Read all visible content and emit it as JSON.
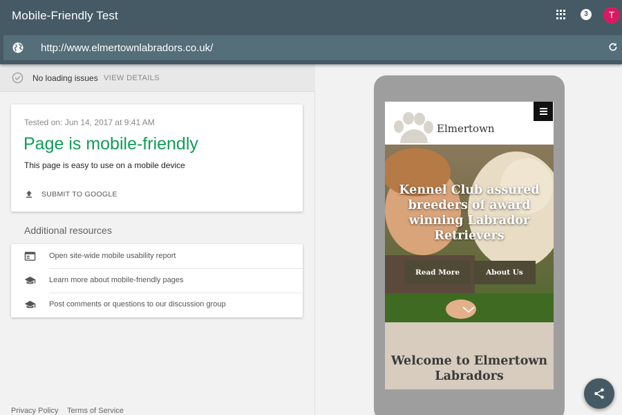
{
  "header": {
    "title": "Mobile-Friendly Test",
    "notification_count": "3",
    "avatar_initial": "T",
    "apps_icon": "apps-grid-icon"
  },
  "url_bar": {
    "value": "http://www.elmertownlabradors.co.uk/",
    "left_icon": "globe-icon",
    "right_icon": "reload-icon"
  },
  "status": {
    "text": "No loading issues",
    "action": "VIEW DETAILS",
    "icon": "check-circle-icon"
  },
  "result": {
    "tested_on": "Tested on: Jun 14, 2017 at 9:41 AM",
    "title": "Page is mobile-friendly",
    "subtitle": "This page is easy to use on a mobile device",
    "submit_label": "SUBMIT TO GOOGLE",
    "title_color": "#0f9d58"
  },
  "resources": {
    "heading": "Additional resources",
    "items": [
      {
        "label": "Open site-wide mobile usability report",
        "icon": "browser-window-icon"
      },
      {
        "label": "Learn more about mobile-friendly pages",
        "icon": "graduation-cap-icon"
      },
      {
        "label": "Post comments or questions to our discussion group",
        "icon": "graduation-cap-icon"
      }
    ]
  },
  "footer": {
    "links": [
      "Privacy Policy",
      "Terms of Service"
    ]
  },
  "preview": {
    "site_name": "Elmertown",
    "hero_headline": "Kennel Club assured breeders of award winning Labrador Retrievers",
    "buttons": [
      "Read More",
      "About Us"
    ],
    "welcome": "Welcome to Elmertown Labradors"
  },
  "colors": {
    "header_bg": "#455a64",
    "url_bar_bg": "#546e7a",
    "avatar_bg": "#d81b60",
    "hero_button_bg": "#4e4a36",
    "welcome_bg": "#d7ccbe"
  }
}
